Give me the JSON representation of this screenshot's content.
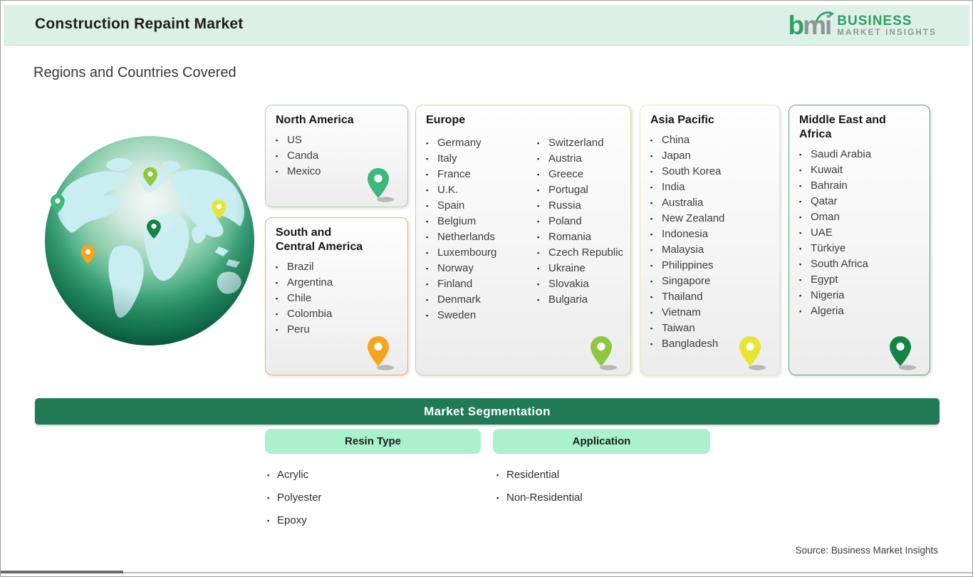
{
  "ui": {
    "bullet_glyph": "▪",
    "brand_green": "#2f9e68",
    "brand_gray": "#8d9598",
    "header_bg": "#ddf0e7",
    "seg_bar_bg": "#1f7a55",
    "chip_bg": "#abf1ce"
  },
  "header": {
    "title": "Construction Repaint Market",
    "logo": {
      "mark_b": "b",
      "mark_m": "m",
      "mark_i": "i",
      "line1": "BUSINESS",
      "line2": "MARKET  INSIGHTS"
    }
  },
  "page": {
    "subtitle": "Regions and Countries Covered",
    "source": "Source: Business Market Insights"
  },
  "regions": [
    {
      "title": "North America",
      "border_color": "#a0d9b4",
      "pin_color": "#3cb878",
      "items": [
        "US",
        "Canda",
        "Mexico"
      ]
    },
    {
      "title": "South and Central America",
      "border_color": "#f4b04f",
      "pin_color": "#f7a41d",
      "items": [
        "Brazil",
        "Argentina",
        "Chile",
        "Colombia",
        "Peru"
      ]
    },
    {
      "title": "Europe",
      "border_color": "#c9dd93",
      "pin_color": "#8fc73e",
      "items_col1": [
        "Germany",
        "Italy",
        "France",
        "U.K.",
        "Spain",
        "Belgium",
        "Netherlands",
        "Luxembourg",
        "Norway",
        "Finland",
        "Denmark",
        "Sweden"
      ],
      "items_col2": [
        "Switzerland",
        "Austria",
        "Greece",
        "Portugal",
        "Russia",
        "Poland",
        "Romania",
        "Czech Republic",
        "Ukraine",
        "Slovakia",
        "Bulgaria"
      ]
    },
    {
      "title": "Asia Pacific",
      "border_color": "#efe9a0",
      "pin_color": "#e7e52f",
      "items": [
        "China",
        "Japan",
        "South Korea",
        "India",
        "Australia",
        "New Zealand",
        "Indonesia",
        "Malaysia",
        "Philippines",
        "Singapore",
        "Thailand",
        "Vietnam",
        "Taiwan",
        "Bangladesh"
      ]
    },
    {
      "title": "Middle East and Africa",
      "border_color": "#5aa573",
      "pin_color": "#148442",
      "items": [
        "Saudi Arabia",
        "Kuwait",
        "Bahrain",
        "Qatar",
        "Oman",
        "UAE",
        "Türkiye",
        "South Africa",
        "Egypt",
        "Nigeria",
        "Algeria"
      ]
    }
  ],
  "segmentation": {
    "title": "Market Segmentation",
    "columns": [
      {
        "header": "Resin Type",
        "items": [
          "Acrylic",
          "Polyester",
          "Epoxy"
        ]
      },
      {
        "header": "Application",
        "items": [
          "Residential",
          "Non-Residential"
        ]
      }
    ]
  }
}
